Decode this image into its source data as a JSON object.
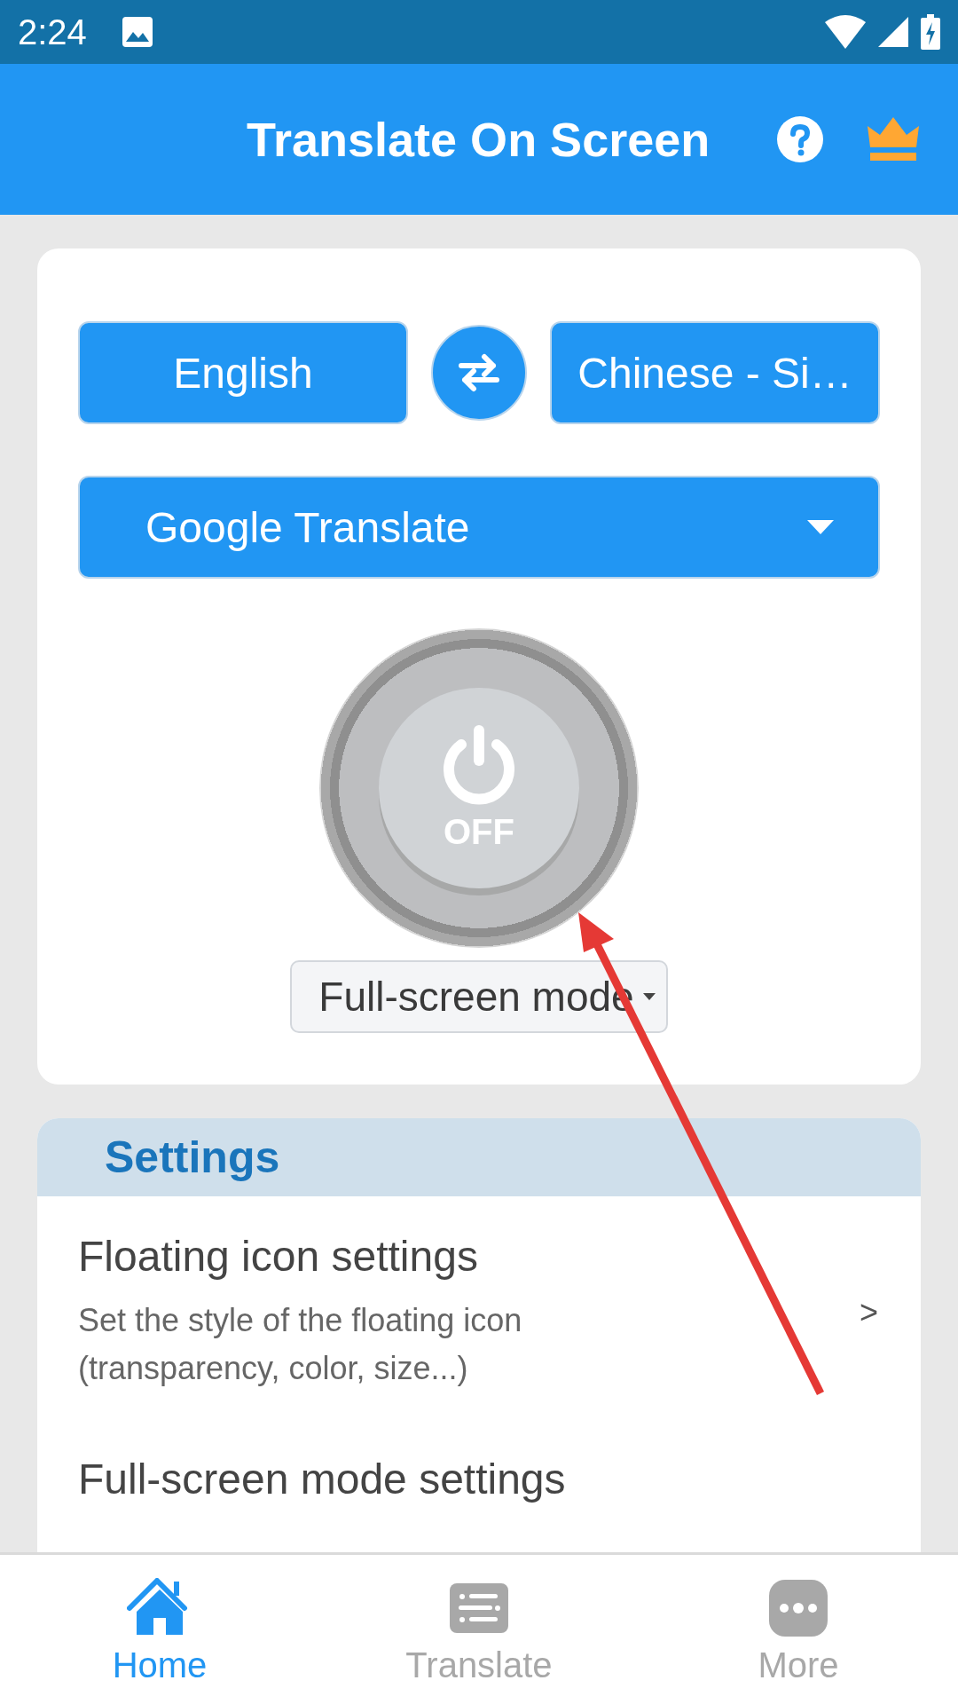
{
  "status_bar": {
    "time": "2:24"
  },
  "app_bar": {
    "title": "Translate On Screen"
  },
  "languages": {
    "source": "English",
    "target": "Chinese - Si…"
  },
  "engine": {
    "label": "Google Translate"
  },
  "power": {
    "on": false,
    "label": "OFF"
  },
  "mode": {
    "label": "Full-screen mode"
  },
  "settings": {
    "title": "Settings",
    "items": [
      {
        "title": "Floating icon settings",
        "description": "Set the style of the floating icon (transparency, color, size...)",
        "chevron": ">"
      },
      {
        "title": "Full-screen mode settings"
      }
    ]
  },
  "bottom_nav": [
    {
      "kind": "home",
      "label": "Home",
      "selected": true
    },
    {
      "kind": "translate",
      "label": "Translate",
      "selected": false
    },
    {
      "kind": "more",
      "label": "More",
      "selected": false
    }
  ]
}
